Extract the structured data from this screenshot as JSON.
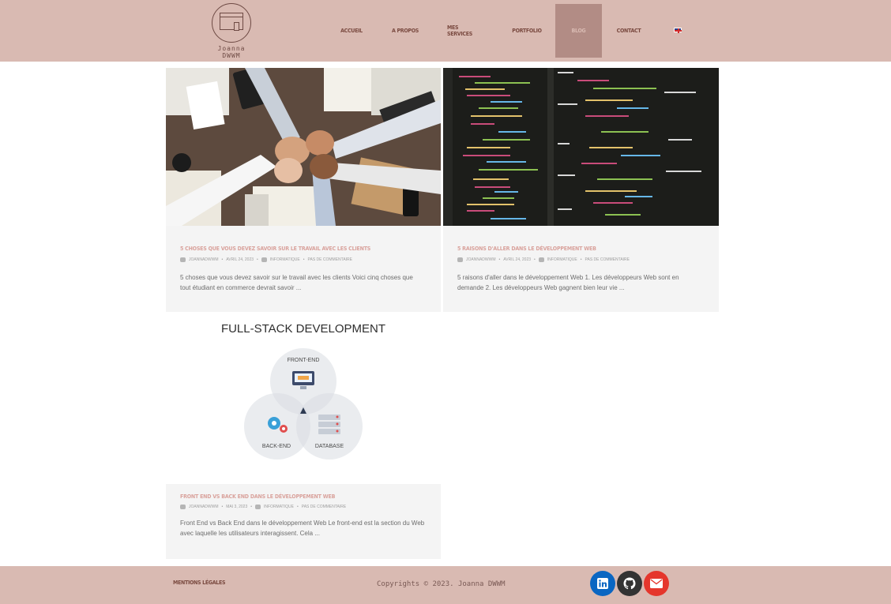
{
  "header": {
    "logo_text": "Joanna DWWM",
    "nav": [
      {
        "label": "Accueil",
        "active": false
      },
      {
        "label": "A propos",
        "active": false
      },
      {
        "label": "Mes services",
        "active": false
      },
      {
        "label": "Portfolio",
        "active": false
      },
      {
        "label": "Blog",
        "active": true
      },
      {
        "label": "Contact",
        "active": false
      }
    ],
    "language_flag": "uk-flag-icon"
  },
  "posts": [
    {
      "title": "5 choses que vous devez savoir sur le travail avec les clients",
      "author": "joannadwwm",
      "date": "avril 24, 2023",
      "category": "Informatique",
      "comments": "Pas de commentaire",
      "excerpt": "5 choses que vous devez savoir sur le travail avec les clients Voici cinq choses que tout étudiant en commerce devrait savoir ..."
    },
    {
      "title": "5 raisons d'aller dans le développement Web",
      "author": "joannadwwm",
      "date": "avril 24, 2023",
      "category": "Informatique",
      "comments": "Pas de commentaire",
      "excerpt": "5 raisons d'aller dans le développement Web 1. Les développeurs Web sont en demande 2. Les développeurs Web gagnent bien leur vie ..."
    },
    {
      "title": "Front End vs Back End dans le développement Web",
      "author": "joannadwwm",
      "date": "mai 3, 2023",
      "category": "Informatique",
      "comments": "Pas de commentaire",
      "excerpt": "Front End vs Back End dans le développement Web Le front-end est la section du Web avec laquelle les utilisateurs interagissent. Cela ...",
      "image": {
        "title": "FULL-STACK DEVELOPMENT",
        "labels": [
          "FRONT-END",
          "BACK-END",
          "DATABASE"
        ]
      }
    }
  ],
  "footer": {
    "legal": "Mentions légales",
    "copyright": "Copyrights © 2023. Joanna DWWM",
    "social": [
      {
        "icon": "linkedin-icon",
        "color": "#0a66c2"
      },
      {
        "icon": "github-icon",
        "color": "#333333"
      },
      {
        "icon": "envelope-icon",
        "color": "#e5362c"
      }
    ]
  },
  "colors": {
    "brand": "#d9bab2",
    "nav_text": "#7a4a40",
    "active_nav": "#b28c85",
    "post_title": "#d9a29c"
  }
}
